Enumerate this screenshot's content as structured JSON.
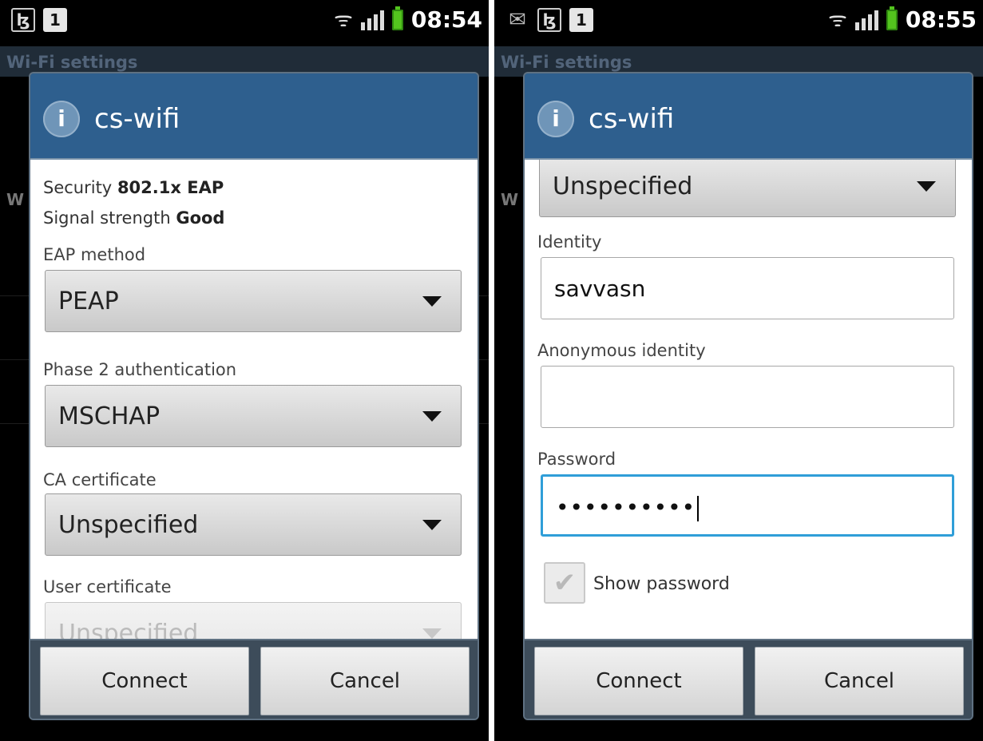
{
  "left": {
    "status": {
      "time": "08:54"
    },
    "background": {
      "title": "Wi-Fi settings",
      "row_letter": "W"
    },
    "dialog": {
      "title": "cs-wifi",
      "security_label": "Security",
      "security_value": "802.1x EAP",
      "signal_label": "Signal strength",
      "signal_value": "Good",
      "eap_label": "EAP method",
      "eap_value": "PEAP",
      "phase2_label": "Phase 2 authentication",
      "phase2_value": "MSCHAP",
      "ca_label": "CA certificate",
      "ca_value": "Unspecified",
      "user_cert_label": "User certificate",
      "user_cert_value": "Unspecified",
      "connect": "Connect",
      "cancel": "Cancel"
    }
  },
  "right": {
    "status": {
      "time": "08:55"
    },
    "background": {
      "title": "Wi-Fi settings",
      "row_letter": "W"
    },
    "dialog": {
      "title": "cs-wifi",
      "user_cert_value": "Unspecified",
      "identity_label": "Identity",
      "identity_value": "savvasn",
      "anon_label": "Anonymous identity",
      "anon_value": "",
      "password_label": "Password",
      "password_value": "••••••••••",
      "show_password_label": "Show password",
      "connect": "Connect",
      "cancel": "Cancel"
    }
  },
  "icons": {
    "info": "i",
    "usb_debug": "ɮ",
    "sim": "1",
    "mail": "✉",
    "wifi": "ᯤ",
    "check": "✔"
  }
}
